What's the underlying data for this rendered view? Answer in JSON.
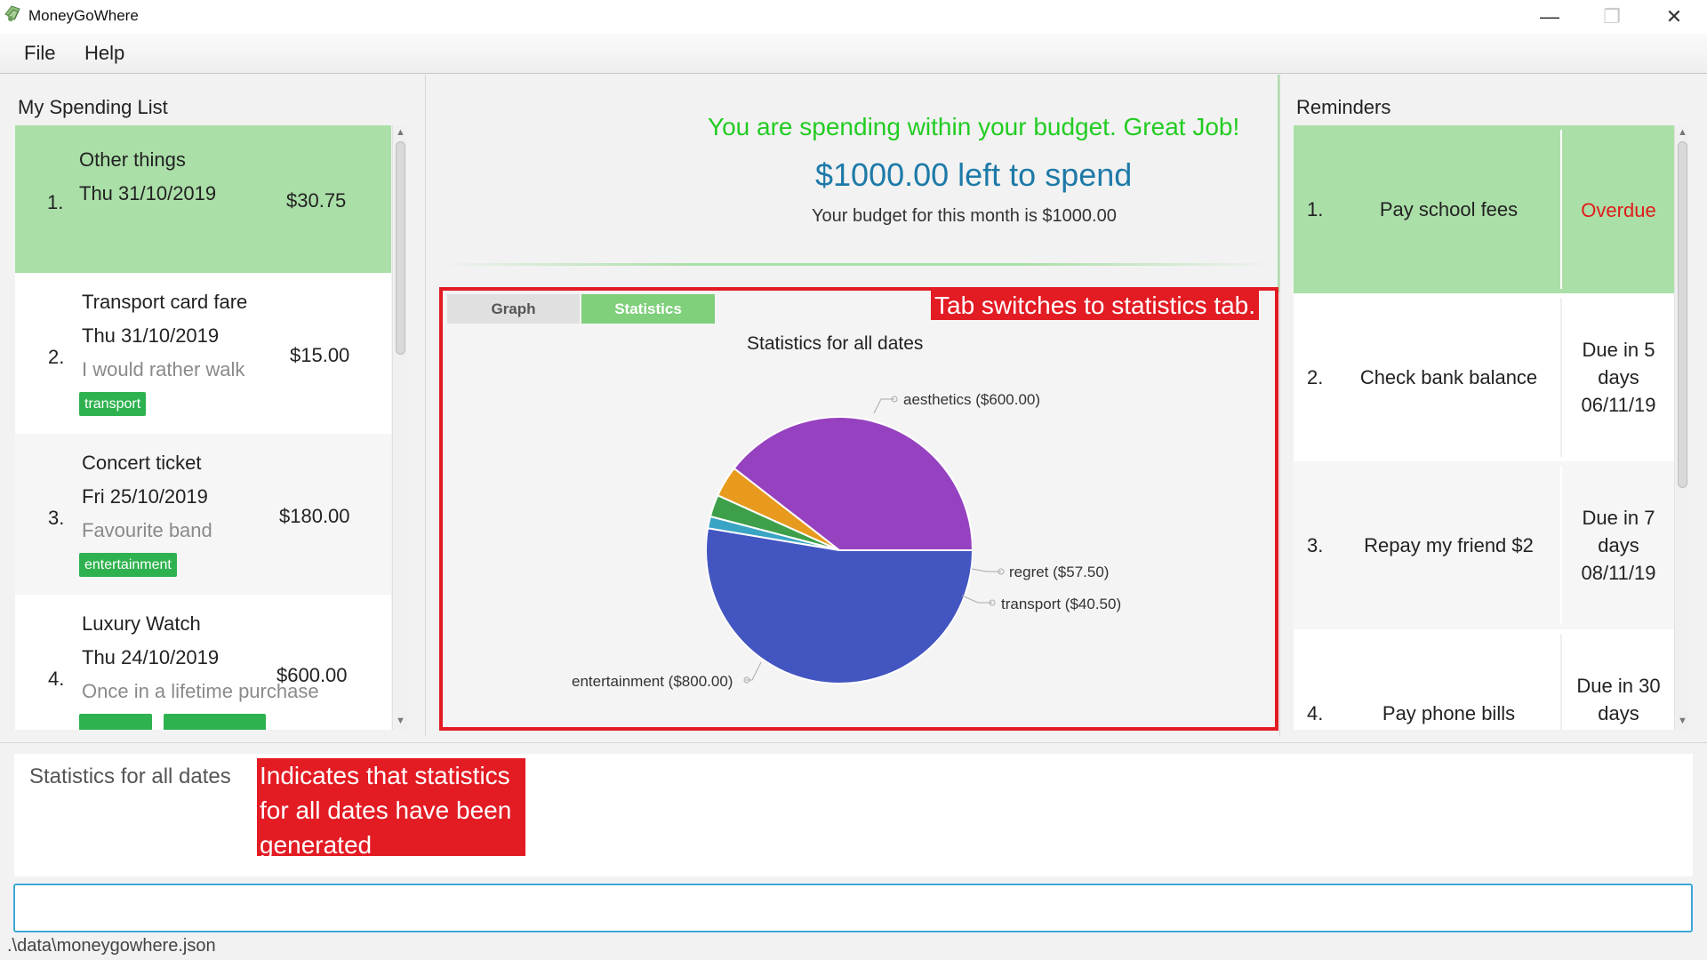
{
  "window": {
    "title": "MoneyGoWhere",
    "minimize_glyph": "—",
    "maximize_glyph": "❐",
    "close_glyph": "✕"
  },
  "menu": {
    "file": "File",
    "help": "Help"
  },
  "spending_panel": {
    "title": "My Spending List",
    "items": [
      {
        "index": "1.",
        "name": "Other things",
        "date": "Thu 31/10/2019",
        "remark": "",
        "amount": "$30.75",
        "tags": []
      },
      {
        "index": "2.",
        "name": "Transport card fare",
        "date": "Thu 31/10/2019",
        "remark": "I would rather walk",
        "amount": "$15.00",
        "tags": [
          "transport"
        ]
      },
      {
        "index": "3.",
        "name": "Concert ticket",
        "date": "Fri 25/10/2019",
        "remark": "Favourite band",
        "amount": "$180.00",
        "tags": [
          "entertainment"
        ]
      },
      {
        "index": "4.",
        "name": "Luxury Watch",
        "date": "Thu 24/10/2019",
        "remark": "Once in a lifetime purchase",
        "amount": "$600.00",
        "tags": [
          "",
          ""
        ]
      }
    ]
  },
  "budget": {
    "message": "You are spending within your budget. Great Job!",
    "left_to_spend": "$1000.00 left to spend",
    "monthly": "Your budget for this month is $1000.00",
    "message_color": "#22cc22",
    "left_color": "#1d7aa8"
  },
  "tabs": {
    "graph": "Graph",
    "statistics": "Statistics",
    "active": "Statistics"
  },
  "annotations": {
    "tab": "Tab switches to statistics tab.",
    "result": "Indicates that statistics for all dates have been generated",
    "color": "#e31b23"
  },
  "chart_data": {
    "type": "pie",
    "title": "Statistics for all dates",
    "slices": [
      {
        "label": "aesthetics ($600.00)",
        "category": "aesthetics",
        "value": 600.0,
        "color": "#9642c0"
      },
      {
        "label": "regret ($57.50)",
        "category": "regret",
        "value": 57.5,
        "color": "#e89a1e"
      },
      {
        "label": "transport ($40.50)",
        "category": "transport",
        "value": 40.5,
        "color": "#3e9f4a"
      },
      {
        "label": "",
        "category": "",
        "value": 22.0,
        "color": "#3aa4c4"
      },
      {
        "label": "entertainment ($800.00)",
        "category": "entertainment",
        "value": 800.0,
        "color": "#4355c0"
      }
    ]
  },
  "reminders": {
    "title": "Reminders",
    "items": [
      {
        "index": "1.",
        "description": "Pay school fees",
        "status": [
          "Overdue"
        ],
        "overdue": true
      },
      {
        "index": "2.",
        "description": "Check bank balance",
        "status": [
          "Due in 5",
          "days",
          "06/11/19"
        ],
        "overdue": false
      },
      {
        "index": "3.",
        "description": "Repay my friend $2",
        "status": [
          "Due in 7",
          "days",
          "08/11/19"
        ],
        "overdue": false
      },
      {
        "index": "4.",
        "description": "Pay phone bills",
        "status": [
          "Due in 30",
          "days"
        ],
        "overdue": false
      }
    ]
  },
  "result_display": "Statistics for all dates",
  "command_box": {
    "value": "",
    "placeholder": ""
  },
  "status_bar": ".\\data\\moneygowhere.json",
  "colors": {
    "selected_row": "#abdfa8",
    "tag": "#2eb24f",
    "overdue": "#e11a1a"
  }
}
